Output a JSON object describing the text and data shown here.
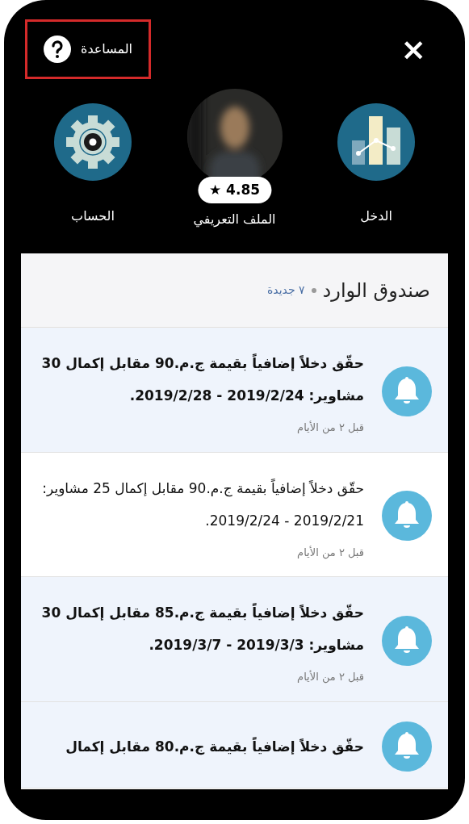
{
  "help": {
    "label": "المساعدة",
    "highlighted": true
  },
  "close": {
    "label": "×"
  },
  "shortcuts": [
    {
      "kind": "chart",
      "label": "الدخل"
    },
    {
      "kind": "avatar",
      "label": "الملف التعريفي",
      "rating": "★ 4.85"
    },
    {
      "kind": "gear",
      "label": "الحساب"
    }
  ],
  "inbox": {
    "title": "صندوق الوارد",
    "new_count": "٧ جديدة",
    "items": [
      {
        "text": "حقّق دخلاً إضافياً بقيمة ج.م.90 مقابل إكمال 30 مشاوير: 2019/2/24 - 2019/2/28.",
        "time": "قبل ٢ من الأيام",
        "unread": true
      },
      {
        "text": "حقّق دخلاً إضافياً بقيمة ج.م.90 مقابل إكمال 25 مشاوير: 2019/2/21 - 2019/2/24.",
        "time": "قبل ٢ من الأيام",
        "unread": false
      },
      {
        "text": "حقّق دخلاً إضافياً بقيمة ج.م.85 مقابل إكمال 30 مشاوير: 2019/3/3 - 2019/3/7.",
        "time": "قبل ٢ من الأيام",
        "unread": true
      },
      {
        "text": "حقّق دخلاً إضافياً بقيمة ج.م.80 مقابل إكمال",
        "unread": true
      }
    ]
  }
}
